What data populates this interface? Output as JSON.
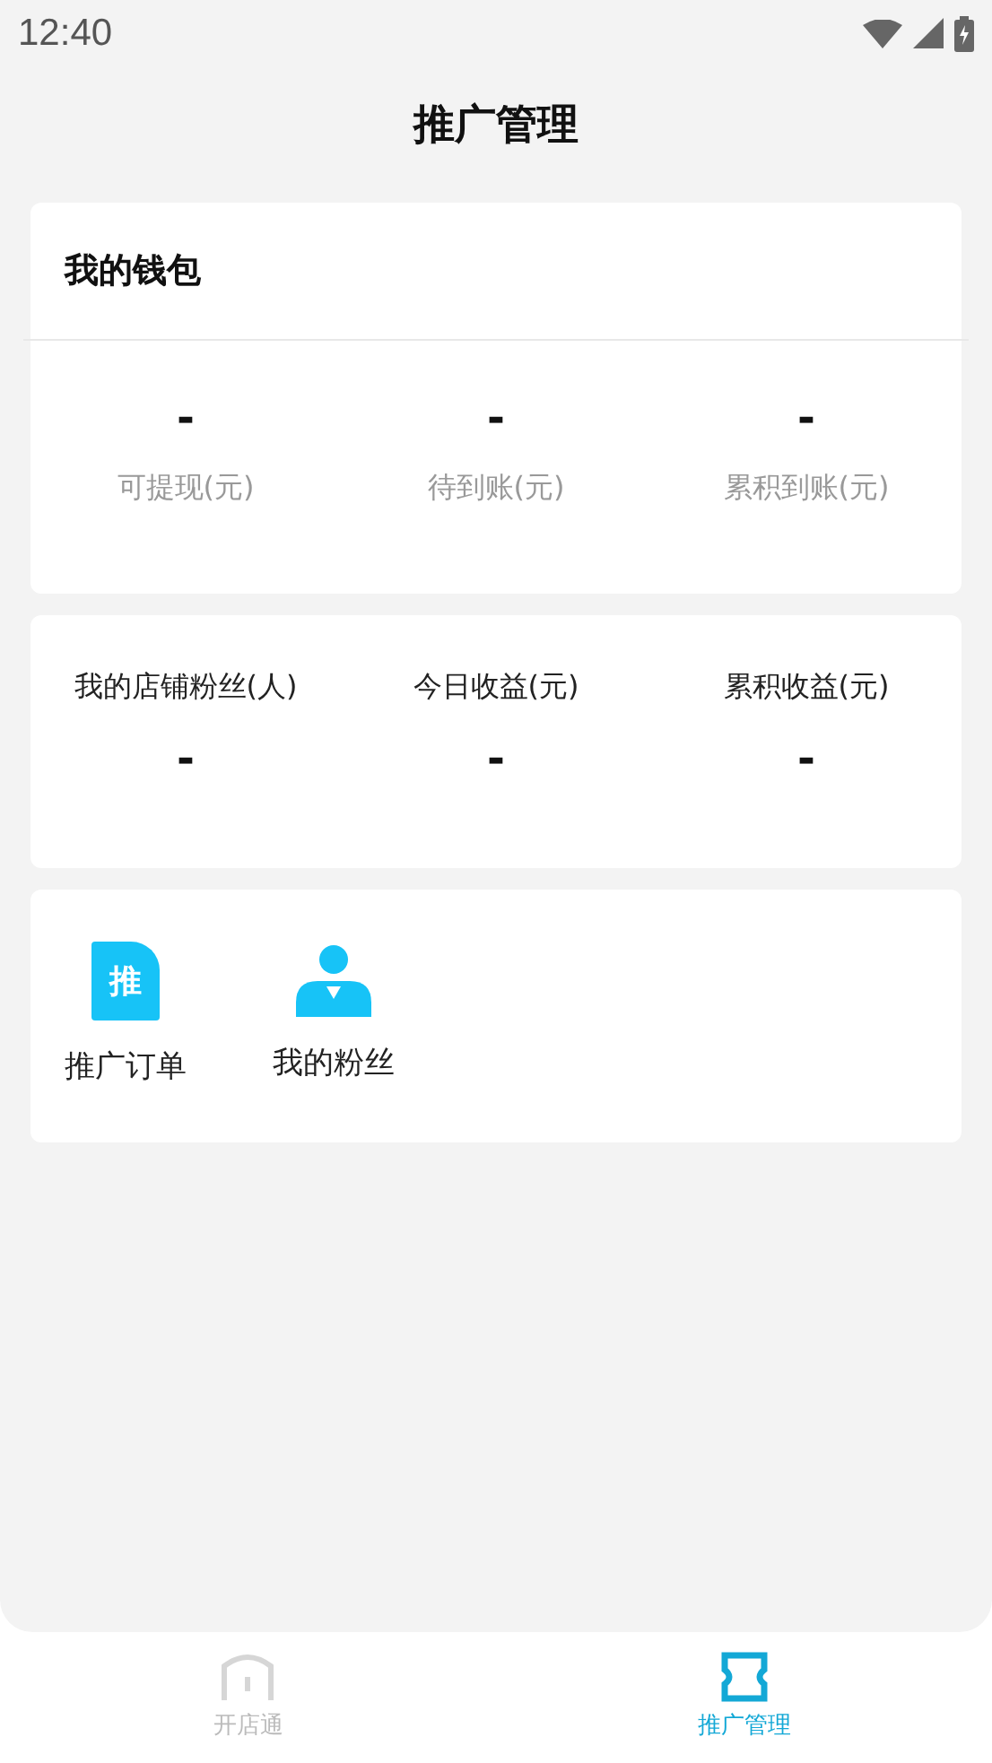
{
  "status_bar": {
    "time": "12:40"
  },
  "title": "推广管理",
  "wallet": {
    "title": "我的钱包",
    "items": [
      {
        "value": "-",
        "label": "可提现(元)"
      },
      {
        "value": "-",
        "label": "待到账(元)"
      },
      {
        "value": "-",
        "label": "累积到账(元)"
      }
    ]
  },
  "stats": [
    {
      "label": "我的店铺粉丝(人)",
      "value": "-"
    },
    {
      "label": "今日收益(元)",
      "value": "-"
    },
    {
      "label": "累积收益(元)",
      "value": "-"
    }
  ],
  "shortcuts": [
    {
      "kind": "document",
      "icon_text": "推",
      "label": "推广订单"
    },
    {
      "kind": "person",
      "label": "我的粉丝"
    }
  ],
  "tab_bar": [
    {
      "kind": "shop",
      "label": "开店通",
      "selected": false
    },
    {
      "kind": "ticket",
      "label": "推广管理",
      "selected": true
    }
  ]
}
